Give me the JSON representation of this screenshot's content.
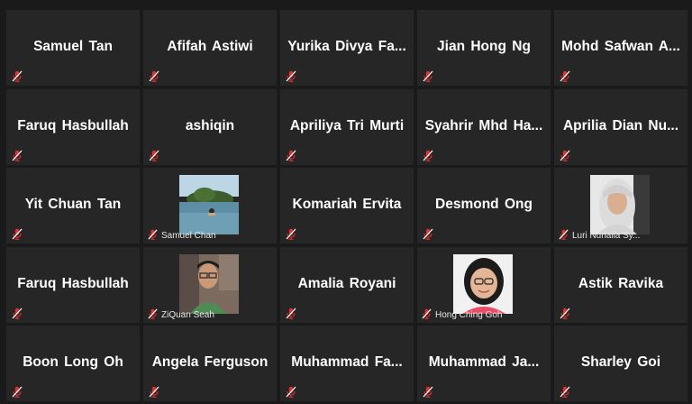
{
  "participants": [
    {
      "name": "Samuel Tan",
      "muted": true
    },
    {
      "name": "Afifah Astiwi",
      "muted": true
    },
    {
      "name": "Yurika Divya Fa...",
      "muted": true
    },
    {
      "name": "Jian Hong Ng",
      "muted": true
    },
    {
      "name": "Mohd Safwan A...",
      "muted": true
    },
    {
      "name": "Faruq Hasbullah",
      "muted": true
    },
    {
      "name": "ashiqin",
      "muted": true
    },
    {
      "name": "Apriliya Tri Murti",
      "muted": true
    },
    {
      "name": "Syahrir Mhd Ha...",
      "muted": true
    },
    {
      "name": "Aprilia Dian Nu...",
      "muted": true
    },
    {
      "name": "Yit Chuan Tan",
      "muted": true
    },
    {
      "name": "Samuel Chan",
      "muted": true,
      "video": "snorkel-photo"
    },
    {
      "name": "Komariah Ervita",
      "muted": true
    },
    {
      "name": "Desmond Ong",
      "muted": true
    },
    {
      "name": "Luri Nurlaila Sy...",
      "muted": true,
      "video": "hijab-portrait"
    },
    {
      "name": "Faruq Hasbullah",
      "muted": true
    },
    {
      "name": "ZiQuan Seah",
      "muted": true,
      "video": "glasses-selfie"
    },
    {
      "name": "Amalia Royani",
      "muted": true
    },
    {
      "name": "Hong Ching Goh",
      "muted": true,
      "video": "glasses-portrait"
    },
    {
      "name": "Astik Ravika",
      "muted": true
    },
    {
      "name": "Boon Long Oh",
      "muted": true
    },
    {
      "name": "Angela Ferguson",
      "muted": true
    },
    {
      "name": "Muhammad Fa...",
      "muted": true
    },
    {
      "name": "Muhammad Ja...",
      "muted": true
    },
    {
      "name": "Sharley Goi",
      "muted": true
    }
  ],
  "colors": {
    "background": "#1a1a1a",
    "tile": "#262626",
    "mute_icon": "#e0302f",
    "name_text": "#ffffff"
  }
}
